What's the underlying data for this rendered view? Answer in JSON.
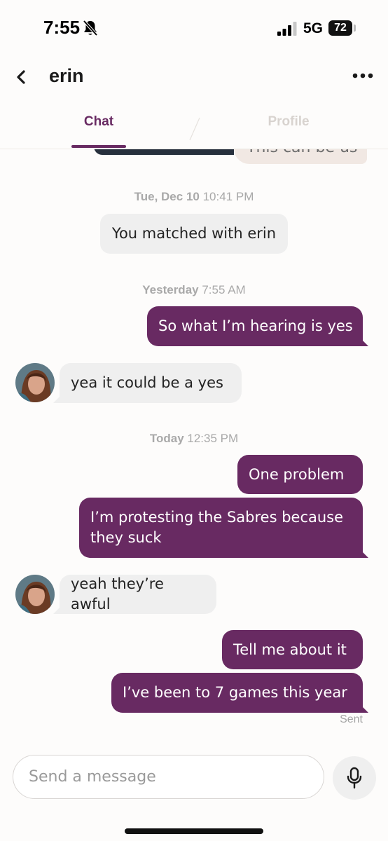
{
  "status_bar": {
    "time": "7:55",
    "network": "5G",
    "battery": "72"
  },
  "header": {
    "contact_name": "erin"
  },
  "tabs": [
    {
      "label": "Chat",
      "active": true
    },
    {
      "label": "Profile",
      "active": false
    }
  ],
  "peek": {
    "partial_text": "This can be us"
  },
  "conversation": {
    "ts_matched": {
      "day": "Tue, Dec 10",
      "time": "10:41 PM"
    },
    "system_message": "You matched with erin",
    "ts_yesterday": {
      "day": "Yesterday",
      "time": "7:55 AM"
    },
    "ts_today": {
      "day": "Today",
      "time": "12:35 PM"
    },
    "messages": [
      {
        "from": "me",
        "text": "So what I’m hearing is yes"
      },
      {
        "from": "erin",
        "text": "yea it could be a yes"
      },
      {
        "from": "me",
        "text": "One problem"
      },
      {
        "from": "me",
        "text": "I’m protesting the Sabres because they suck"
      },
      {
        "from": "erin",
        "text": "yeah they’re awful"
      },
      {
        "from": "me",
        "text": "Tell me about it"
      },
      {
        "from": "me",
        "text": "I’ve been to 7 games this year"
      }
    ],
    "delivery_status": "Sent"
  },
  "composer": {
    "placeholder": "Send a message"
  },
  "colors": {
    "accent": "#682a62",
    "incoming_bubble": "#efefef",
    "background": "#fdfcfb"
  },
  "icons": [
    "bell-off-icon",
    "signal-icon",
    "battery-icon",
    "back-chevron-icon",
    "more-dots-icon",
    "microphone-icon"
  ]
}
